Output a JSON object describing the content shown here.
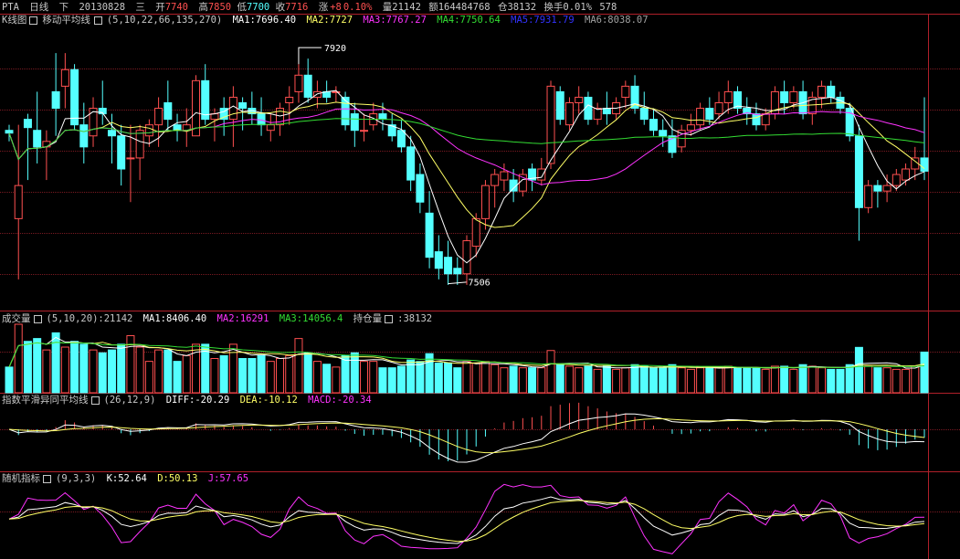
{
  "colors": {
    "bg": "#000000",
    "rise": "#ff5050",
    "fall": "#54ffff",
    "grid": "#b0202a",
    "white": "#ffffff",
    "yellow": "#ffff66",
    "magenta": "#ff33ff",
    "green": "#33dd33",
    "blue": "#3333ff",
    "gray": "#a0a0a0",
    "text": "#c8c8c8"
  },
  "header": {
    "symbol": "PTA",
    "period": "日线",
    "adj": "下",
    "date": "20130828",
    "weekday": "三",
    "open_label": "开",
    "open": "7740",
    "high_label": "高",
    "high": "7850",
    "low_label": "低",
    "low": "7700",
    "close_label": "收",
    "close": "7716",
    "chg_label": "涨",
    "chg": "+8",
    "chg_pct": "0.10%",
    "vol": "量21142",
    "amount": "额164484768",
    "oi": "仓38132",
    "turnover": "换手0.01%",
    "tail": "578"
  },
  "main_legend": {
    "name": "K线图",
    "indicator": "移动平均线",
    "params": "(5,10,22,66,135,270)",
    "ma1": "MA1:7696.40",
    "ma2": "MA2:7727",
    "ma3": "MA3:7767.27",
    "ma4": "MA4:7750.64",
    "ma5": "MA5:7931.79",
    "ma6": "MA6:8038.07"
  },
  "annotations": {
    "high": "7920",
    "low": "7506"
  },
  "volume_legend": {
    "name": "成交量",
    "params": "(5,10,20)",
    "value": ":21142",
    "ma1": "MA1:8406.40",
    "ma2": "MA2:16291",
    "ma3": "MA3:14056.4",
    "oi_label": "持仓量",
    "oi": ":38132"
  },
  "macd_legend": {
    "name": "指数平滑异同平均线",
    "params": "(26,12,9)",
    "diff": "DIFF:-20.29",
    "dea": "DEA:-10.12",
    "macd": "MACD:-20.34"
  },
  "kdj_legend": {
    "name": "随机指标",
    "params": "(9,3,3)",
    "k": "K:52.64",
    "d": "D:50.13",
    "j": "J:57.65"
  },
  "chart_data": {
    "type": "candlestick",
    "price_range": [
      7480,
      7960
    ],
    "candles": [
      [
        7790,
        7800,
        7770,
        7785
      ],
      [
        7630,
        7800,
        7520,
        7690
      ],
      [
        7810,
        7820,
        7700,
        7795
      ],
      [
        7790,
        7860,
        7730,
        7760
      ],
      [
        7760,
        7790,
        7700,
        7770
      ],
      [
        7860,
        7930,
        7780,
        7830
      ],
      [
        7870,
        7930,
        7830,
        7900
      ],
      [
        7900,
        7910,
        7790,
        7800
      ],
      [
        7800,
        7840,
        7730,
        7760
      ],
      [
        7780,
        7850,
        7760,
        7830
      ],
      [
        7830,
        7880,
        7800,
        7820
      ],
      [
        7790,
        7820,
        7730,
        7780
      ],
      [
        7780,
        7800,
        7690,
        7720
      ],
      [
        7740,
        7800,
        7660,
        7740
      ],
      [
        7740,
        7800,
        7700,
        7790
      ],
      [
        7780,
        7810,
        7760,
        7800
      ],
      [
        7800,
        7850,
        7760,
        7830
      ],
      [
        7840,
        7880,
        7790,
        7810
      ],
      [
        7800,
        7820,
        7770,
        7790
      ],
      [
        7790,
        7830,
        7760,
        7800
      ],
      [
        7780,
        7890,
        7780,
        7880
      ],
      [
        7880,
        7910,
        7800,
        7810
      ],
      [
        7810,
        7830,
        7770,
        7820
      ],
      [
        7830,
        7850,
        7780,
        7810
      ],
      [
        7810,
        7870,
        7760,
        7850
      ],
      [
        7840,
        7850,
        7790,
        7830
      ],
      [
        7830,
        7860,
        7800,
        7820
      ],
      [
        7820,
        7850,
        7780,
        7800
      ],
      [
        7790,
        7820,
        7770,
        7800
      ],
      [
        7800,
        7840,
        7780,
        7830
      ],
      [
        7840,
        7870,
        7800,
        7850
      ],
      [
        7860,
        7910,
        7840,
        7890
      ],
      [
        7890,
        7920,
        7840,
        7850
      ],
      [
        7850,
        7880,
        7830,
        7860
      ],
      [
        7860,
        7880,
        7840,
        7850
      ],
      [
        7860,
        7870,
        7840,
        7860
      ],
      [
        7850,
        7860,
        7790,
        7800
      ],
      [
        7820,
        7840,
        7760,
        7790
      ],
      [
        7790,
        7820,
        7770,
        7790
      ],
      [
        7800,
        7840,
        7790,
        7820
      ],
      [
        7820,
        7840,
        7790,
        7810
      ],
      [
        7800,
        7820,
        7770,
        7780
      ],
      [
        7790,
        7810,
        7750,
        7760
      ],
      [
        7760,
        7780,
        7680,
        7700
      ],
      [
        7710,
        7730,
        7640,
        7660
      ],
      [
        7640,
        7680,
        7540,
        7560
      ],
      [
        7570,
        7600,
        7520,
        7540
      ],
      [
        7560,
        7590,
        7510,
        7530
      ],
      [
        7540,
        7560,
        7510,
        7530
      ],
      [
        7530,
        7600,
        7510,
        7590
      ],
      [
        7580,
        7640,
        7560,
        7630
      ],
      [
        7630,
        7700,
        7610,
        7690
      ],
      [
        7690,
        7720,
        7650,
        7710
      ],
      [
        7700,
        7730,
        7680,
        7715
      ],
      [
        7700,
        7720,
        7660,
        7680
      ],
      [
        7680,
        7720,
        7670,
        7710
      ],
      [
        7720,
        7730,
        7680,
        7700
      ],
      [
        7700,
        7740,
        7690,
        7720
      ],
      [
        7730,
        7880,
        7720,
        7870
      ],
      [
        7860,
        7870,
        7800,
        7810
      ],
      [
        7800,
        7850,
        7790,
        7840
      ],
      [
        7840,
        7870,
        7820,
        7850
      ],
      [
        7850,
        7860,
        7800,
        7810
      ],
      [
        7810,
        7840,
        7800,
        7830
      ],
      [
        7830,
        7860,
        7800,
        7820
      ],
      [
        7820,
        7850,
        7810,
        7840
      ],
      [
        7850,
        7880,
        7830,
        7870
      ],
      [
        7870,
        7890,
        7820,
        7830
      ],
      [
        7830,
        7860,
        7800,
        7810
      ],
      [
        7810,
        7830,
        7780,
        7790
      ],
      [
        7790,
        7810,
        7760,
        7780
      ],
      [
        7780,
        7810,
        7740,
        7750
      ],
      [
        7760,
        7800,
        7750,
        7790
      ],
      [
        7790,
        7820,
        7780,
        7800
      ],
      [
        7800,
        7840,
        7790,
        7830
      ],
      [
        7830,
        7850,
        7800,
        7810
      ],
      [
        7820,
        7860,
        7810,
        7840
      ],
      [
        7840,
        7880,
        7820,
        7860
      ],
      [
        7860,
        7870,
        7820,
        7830
      ],
      [
        7830,
        7850,
        7800,
        7820
      ],
      [
        7820,
        7840,
        7790,
        7800
      ],
      [
        7800,
        7830,
        7790,
        7820
      ],
      [
        7820,
        7870,
        7810,
        7860
      ],
      [
        7860,
        7880,
        7820,
        7840
      ],
      [
        7840,
        7870,
        7830,
        7860
      ],
      [
        7860,
        7880,
        7810,
        7820
      ],
      [
        7820,
        7860,
        7800,
        7850
      ],
      [
        7850,
        7880,
        7830,
        7870
      ],
      [
        7870,
        7880,
        7840,
        7850
      ],
      [
        7850,
        7860,
        7820,
        7830
      ],
      [
        7830,
        7840,
        7770,
        7780
      ],
      [
        7780,
        7800,
        7590,
        7650
      ],
      [
        7650,
        7700,
        7640,
        7690
      ],
      [
        7690,
        7700,
        7650,
        7680
      ],
      [
        7680,
        7710,
        7660,
        7690
      ],
      [
        7690,
        7720,
        7680,
        7710
      ],
      [
        7700,
        7730,
        7690,
        7720
      ],
      [
        7720,
        7760,
        7700,
        7740
      ],
      [
        7740,
        7850,
        7700,
        7716
      ]
    ]
  }
}
